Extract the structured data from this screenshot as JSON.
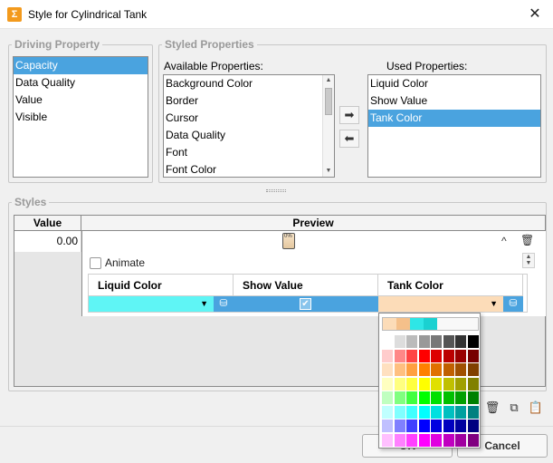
{
  "window": {
    "title": "Style for Cylindrical Tank",
    "close_glyph": "✕",
    "app_icon": "Σ"
  },
  "driving_property": {
    "legend": "Driving Property",
    "items": [
      "Capacity",
      "Data Quality",
      "Value",
      "Visible"
    ],
    "selected_index": 0
  },
  "styled_properties": {
    "legend": "Styled Properties",
    "available_label": "Available Properties:",
    "used_label": "Used Properties:",
    "available": [
      "Background Color",
      "Border",
      "Cursor",
      "Data Quality",
      "Font",
      "Font Color"
    ],
    "used": [
      "Liquid Color",
      "Show Value",
      "Tank Color"
    ],
    "used_selected_index": 2,
    "add_icon": "➡",
    "remove_icon": "⬅"
  },
  "styles": {
    "legend": "Styles",
    "col_value": "Value",
    "col_preview": "Preview",
    "row_value": "0.00",
    "preview_tank_text": "0%",
    "animate_label": "Animate",
    "columns": [
      "Liquid Color",
      "Show Value",
      "Tank Color"
    ],
    "liquid_color": "#5ff5f5",
    "show_value_color": "#4aa3df",
    "tank_color": "#fcdcb8",
    "caret_up": "^",
    "trash_glyph": "🗑",
    "dd_arrow": "▼",
    "bucket": "⛁",
    "check": "✔",
    "spin_up": "▲",
    "spin_down": "▼"
  },
  "toolbar": {
    "delete_icon": "🗑",
    "copy_icon": "⧉",
    "paste_icon": "📋"
  },
  "buttons": {
    "ok": "OK",
    "cancel": "Cancel"
  },
  "palette": {
    "recent": [
      "#fcdcb8",
      "#f5c08a",
      "#2ee6e6",
      "#1ad1d1",
      "#f8f8f8",
      "#f8f8f8",
      "#f8f8f8"
    ],
    "grid": [
      [
        "#ffffff",
        "#dddddd",
        "#bbbbbb",
        "#999999",
        "#777777",
        "#555555",
        "#333333",
        "#000000"
      ],
      [
        "#ffcccc",
        "#ff8888",
        "#ff4444",
        "#ff0000",
        "#dd0000",
        "#bb0000",
        "#990000",
        "#770000"
      ],
      [
        "#ffe0c0",
        "#ffc080",
        "#ffa040",
        "#ff8000",
        "#e07000",
        "#c06000",
        "#a05000",
        "#804000"
      ],
      [
        "#ffffc0",
        "#ffff80",
        "#ffff40",
        "#ffff00",
        "#e0e000",
        "#c0c000",
        "#a0a000",
        "#808000"
      ],
      [
        "#c0ffc0",
        "#80ff80",
        "#40ff40",
        "#00ff00",
        "#00e000",
        "#00c000",
        "#00a000",
        "#008000"
      ],
      [
        "#c0ffff",
        "#80ffff",
        "#40ffff",
        "#00ffff",
        "#00e0e0",
        "#00c0c0",
        "#00a0a0",
        "#008080"
      ],
      [
        "#c0c0ff",
        "#8080ff",
        "#4040ff",
        "#0000ff",
        "#0000e0",
        "#0000c0",
        "#0000a0",
        "#000080"
      ],
      [
        "#ffc0ff",
        "#ff80ff",
        "#ff40ff",
        "#ff00ff",
        "#e000e0",
        "#c000c0",
        "#a000a0",
        "#800080"
      ]
    ]
  }
}
